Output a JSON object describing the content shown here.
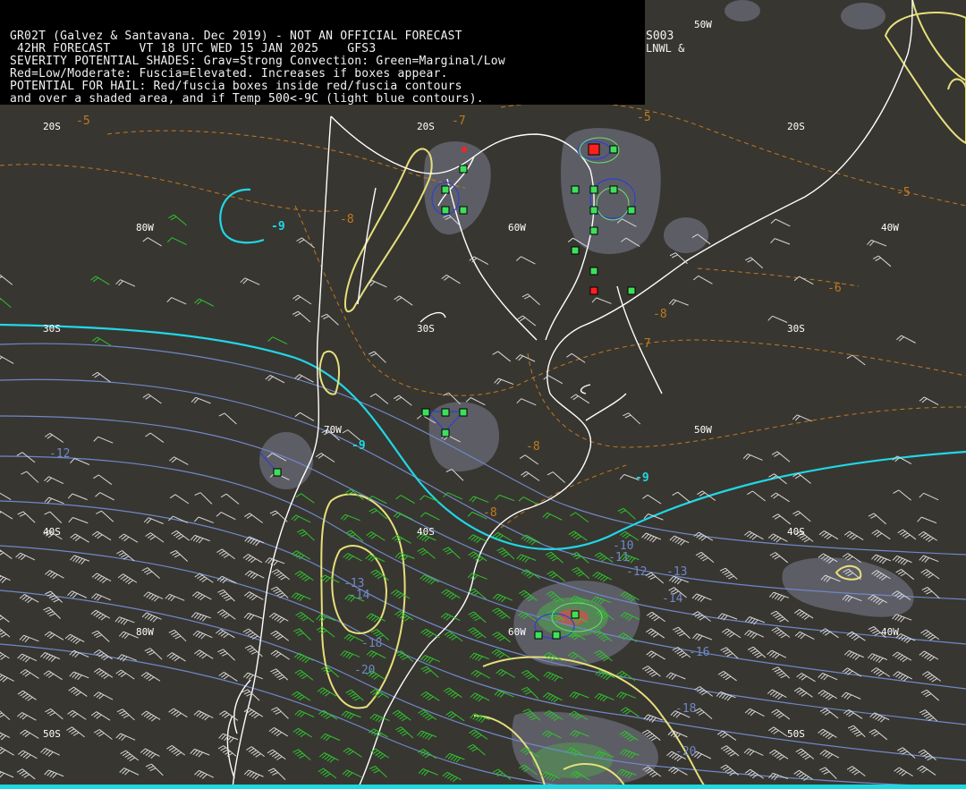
{
  "header": {
    "line1": "GR02T (Galvez & Santavana. Dec 2019) - NOT AN OFFICIAL FORECAST",
    "line2": " 42HR FORECAST    VT 18 UTC WED 15 JAN 2025    GFS3",
    "line3": "SEVERITY POTENTIAL SHADES: Grav=Strong Convection: Green=Marginal/Low",
    "line4": "Red=Low/Moderate: Fuscia=Elevated. Increases if boxes appear.",
    "line5": "POTENTIAL FOR HAIL: Red/fuscia boxes inside red/fuscia contours",
    "line6": "and over a shaded area, and if Temp 500<-9C (light blue contours).",
    "side1": "S003",
    "side2": "LNWL &"
  },
  "grid_labels": {
    "lat20_a": "20S",
    "lat20_b": "20S",
    "lat20_c": "20S",
    "lat30_a": "30S",
    "lat30_b": "30S",
    "lat30_c": "30S",
    "lat40_a": "40S",
    "lat40_b": "40S",
    "lat40_c": "40S",
    "lat50_a": "50S",
    "lat50_b": "50S",
    "lon80_a": "80W",
    "lon60_a": "60W",
    "lon40_a": "40W",
    "lon50_top": "50W",
    "lon70_a": "70W",
    "lon50_a": "50W",
    "lon80_b": "80W",
    "lon60_b": "60W",
    "lon40_b": "40W"
  },
  "contour_labels": {
    "orange": [
      "-5",
      "-7",
      "-8",
      "-5",
      "-5",
      "-6",
      "-8",
      "-7",
      "-8",
      "-8"
    ],
    "cyan": [
      "-9",
      "-9",
      "-9"
    ],
    "blue": [
      "-12",
      "-10",
      "-11",
      "-12",
      "-13",
      "-14",
      "-13",
      "-14",
      "-18",
      "-20",
      "-16",
      "-18",
      "-20"
    ]
  },
  "colors": {
    "background": "#383631",
    "header_bg": "#000000",
    "coast": "#ffffff",
    "orange_contour": "#c07a1e",
    "cyan_contour": "#1fd8e6",
    "blue_contour": "#6f88c8",
    "yellow_contour": "#e6e07a",
    "wind_green": "#2ec42e",
    "wind_white": "#d8d8d8",
    "shade_gray": "#6a6a72",
    "box_green": "#3ee05a",
    "box_red": "#ff2020"
  },
  "legend_features": [
    "severity-shading",
    "hail-boxes",
    "temp-500-contours",
    "wind-barbs"
  ]
}
